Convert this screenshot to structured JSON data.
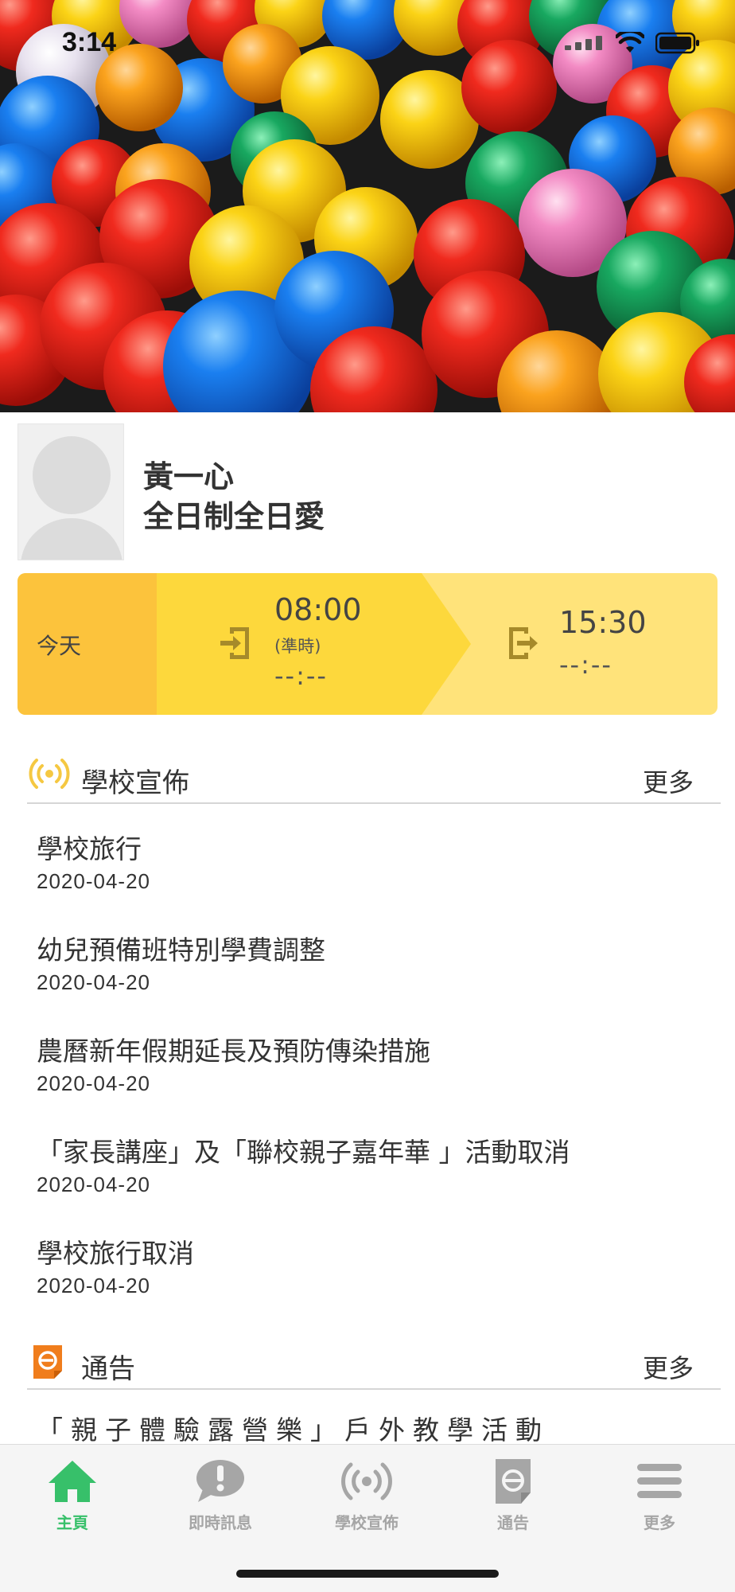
{
  "status_bar": {
    "time": "3:14"
  },
  "profile": {
    "name": "黃一心",
    "class": "全日制全日愛"
  },
  "attendance": {
    "today_label": "今天",
    "check_in": {
      "scheduled": "08:00",
      "status": "(準時)",
      "actual": "--:--"
    },
    "check_out": {
      "scheduled": "15:30",
      "actual": "--:--"
    }
  },
  "announcements": {
    "title": "學校宣佈",
    "more": "更多",
    "items": [
      {
        "title": "學校旅行",
        "date": "2020-04-20"
      },
      {
        "title": "幼兒預備班特別學費調整",
        "date": "2020-04-20"
      },
      {
        "title": "農曆新年假期延長及預防傳染措施",
        "date": "2020-04-20"
      },
      {
        "title": "「家長講座」及「聯校親子嘉年華 」活動取消",
        "date": "2020-04-20"
      },
      {
        "title": "學校旅行取消",
        "date": "2020-04-20"
      }
    ]
  },
  "notices": {
    "title": "通告",
    "more": "更多",
    "items": [
      {
        "title": "「親子體驗露營樂」戶外教學活動"
      }
    ]
  },
  "tabbar": {
    "tabs": [
      {
        "label": "主頁",
        "icon": "home-icon",
        "active": true
      },
      {
        "label": "即時訊息",
        "icon": "message-alert-icon",
        "active": false
      },
      {
        "label": "學校宣佈",
        "icon": "broadcast-icon",
        "active": false
      },
      {
        "label": "通告",
        "icon": "notice-icon",
        "active": false
      },
      {
        "label": "更多",
        "icon": "menu-icon",
        "active": false
      }
    ],
    "active_color": "#37c06a",
    "inactive_color": "#a6a6a6"
  },
  "colors": {
    "today_cell": "#fcc33c",
    "check_in_cell": "#fdd83c",
    "check_out_cell": "#ffe37a",
    "announce_icon": "#f5c842",
    "notice_icon": "#f07d1c"
  }
}
